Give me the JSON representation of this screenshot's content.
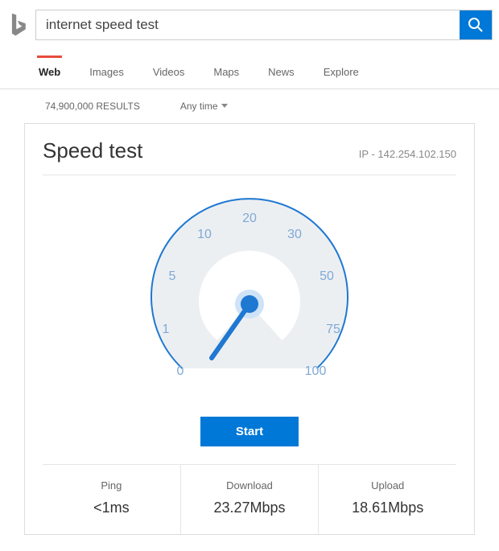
{
  "search": {
    "query": "internet speed test"
  },
  "tabs": {
    "web": "Web",
    "images": "Images",
    "videos": "Videos",
    "maps": "Maps",
    "news": "News",
    "explore": "Explore"
  },
  "meta": {
    "results": "74,900,000 RESULTS",
    "time_filter": "Any time"
  },
  "card": {
    "title": "Speed test",
    "ip_label": "IP - 142.254.102.150",
    "start_label": "Start",
    "ticks": [
      "0",
      "1",
      "5",
      "10",
      "20",
      "30",
      "50",
      "75",
      "100"
    ],
    "stats": {
      "ping": {
        "label": "Ping",
        "value": "<1ms"
      },
      "download": {
        "label": "Download",
        "value": "23.27Mbps"
      },
      "upload": {
        "label": "Upload",
        "value": "18.61Mbps"
      }
    }
  }
}
